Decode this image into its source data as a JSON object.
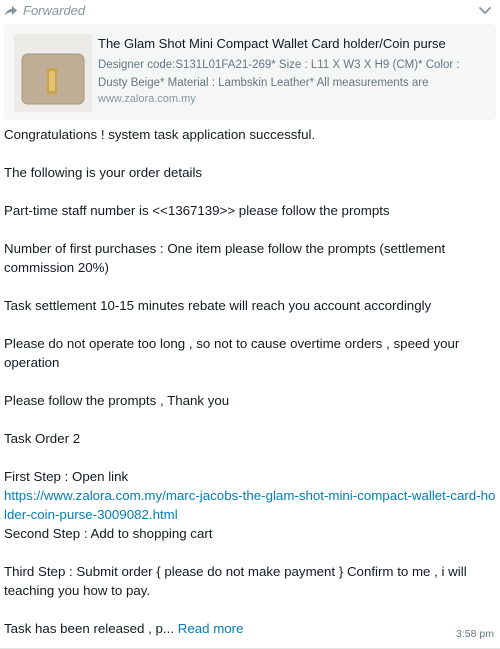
{
  "message": {
    "forwarded_label": "Forwarded",
    "link_preview": {
      "title": "The Glam Shot Mini Compact Wallet Card holder/Coin purse",
      "description": "Designer code:S131L01FA21-269* Size : L11 X W3 X H9 (CM)* Color : Dusty Beige* Material : Lambskin Leather* All measurements are",
      "domain": "www.zalora.com.my"
    },
    "lines": {
      "l1": "Congratulations ! system task application successful.",
      "l2": "The following is your order details",
      "l3": "Part-time staff number is <<1367139>> please follow the prompts",
      "l4": "Number of first purchases : One item please follow the prompts (settlement commission 20%)",
      "l5": "Task settlement 10-15  minutes rebate will reach you account accordingly",
      "l6": "Please do not operate too long , so not to cause overtime orders , speed your operation",
      "l7": "Please follow the prompts , Thank you",
      "l8": "Task Order 2",
      "l9": "First Step : Open link",
      "link_url": "https://www.zalora.com.my/marc-jacobs-the-glam-shot-mini-compact-wallet-card-holder-coin-purse-3009082.html",
      "l10": "Second Step : Add to shopping cart",
      "l11": "Third Step : Submit order { please do not make payment } Confirm to me , i will teaching you how to pay.",
      "l12": "Task has been released , p...",
      "read_more": "Read more"
    },
    "timestamp": "3:58 pm"
  },
  "colors": {
    "link": "#027eb5",
    "meta_text": "#667781",
    "preview_bg": "#f5f6f6"
  },
  "icons": {
    "forward": "forward-arrow-icon",
    "menu": "chevron-down-icon",
    "product": "wallet-thumbnail"
  }
}
